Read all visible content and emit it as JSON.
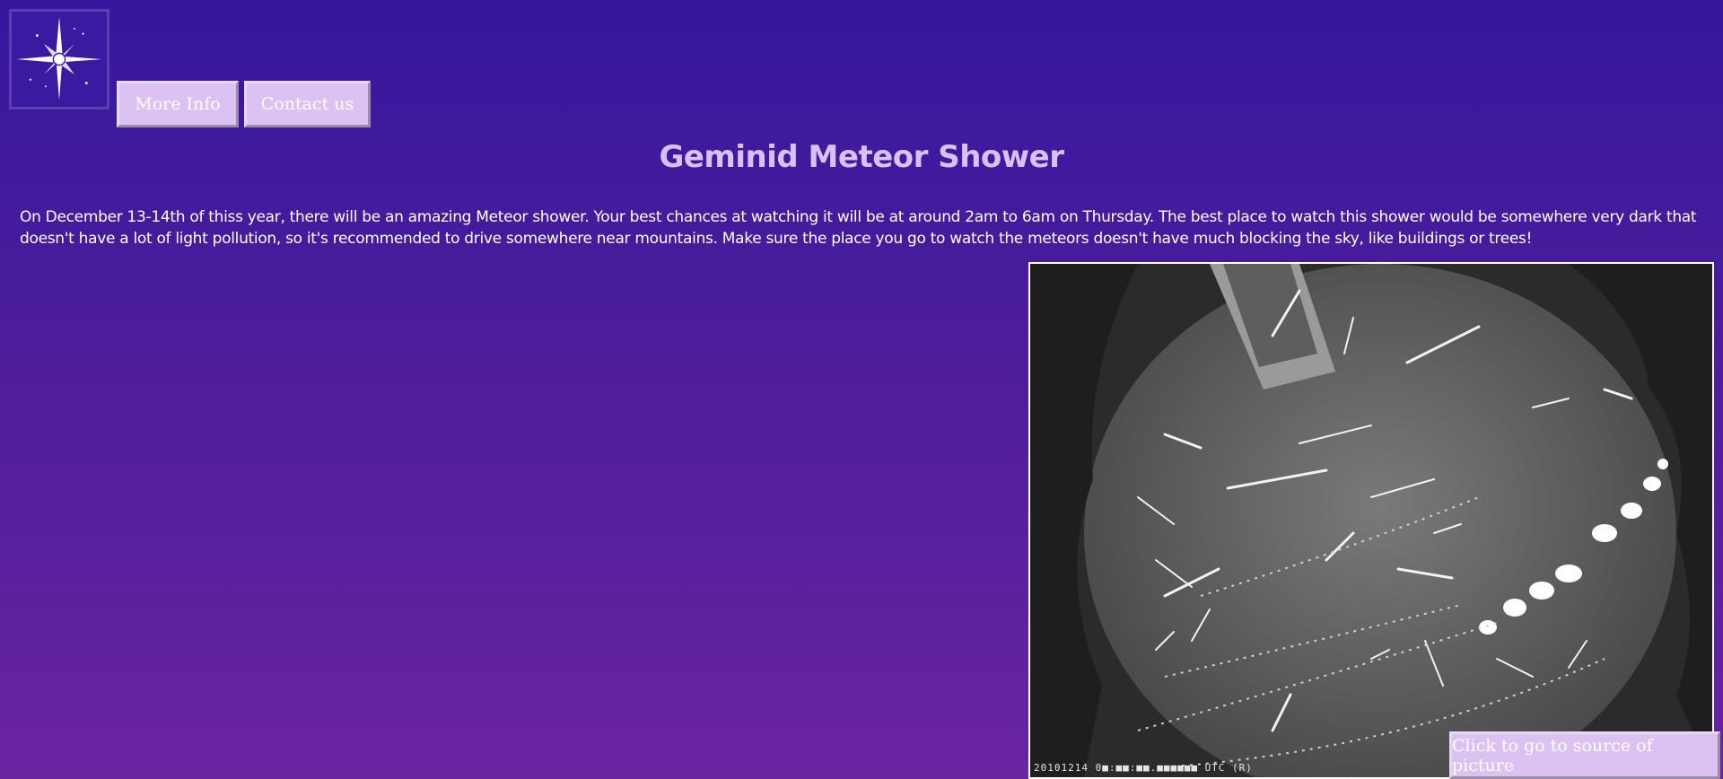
{
  "header": {
    "logo_icon": "sparkle-star-logo-icon",
    "nav": [
      {
        "label": "More Info"
      },
      {
        "label": "Contact us"
      }
    ]
  },
  "main": {
    "title": "Geminid Meteor Shower",
    "description": "On December 13-14th of thiss year, there will be an amazing Meteor shower. Your best chances at watching it will be at around 2am to 6am on Thursday. The best place to watch this shower would be somewhere very dark that doesn't have a lot of light pollution, so it's recommended to drive somewhere near mountains. Make sure the place you go to watch the meteors doesn't have much blocking the sky, like buildings or trees!",
    "photo": {
      "subject": "all-sky-meteor-photo",
      "stamp": "20101214 0■:■■:■■.■■■■■■ UTC (R)"
    },
    "source_button": "Click to go to source of picture"
  },
  "colors": {
    "background_top": "#35189c",
    "background_bottom": "#6a24a0",
    "button_bg": "#dcc2f3",
    "title_color": "#d8c1f5",
    "text_color": "#ffffff"
  }
}
